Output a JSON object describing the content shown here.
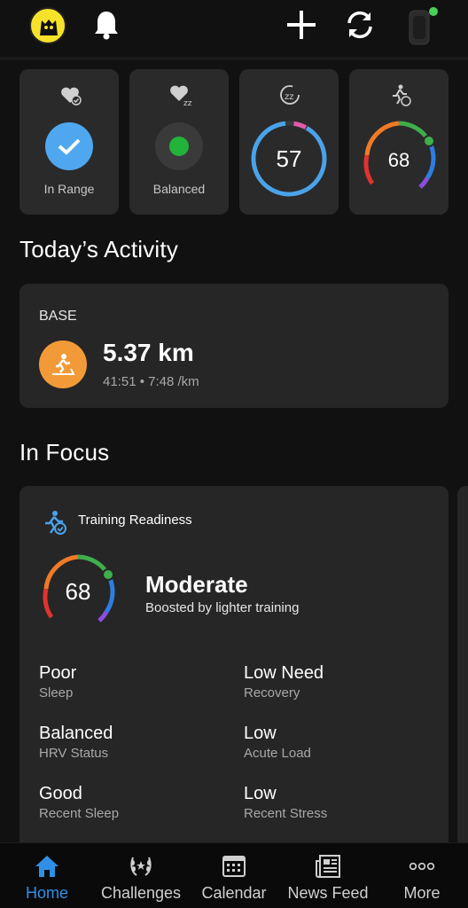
{
  "header": {
    "avatar_icon": "profile-avatar-icon",
    "notifications_icon": "bell-icon",
    "add_icon": "plus-icon",
    "sync_icon": "sync-icon",
    "device_icon": "watch-icon",
    "device_status_color": "#4ccf5a"
  },
  "tiles": [
    {
      "icon": "heart-check-icon",
      "label": "In Range",
      "indicator_color": "#4fa8ef"
    },
    {
      "icon": "heart-zz-icon",
      "label": "Balanced",
      "indicator_color": "#22b33a"
    },
    {
      "icon": "sleep-score-icon",
      "value": "57",
      "ring_color": "#4aa3ea",
      "ring_fraction": 0.57
    },
    {
      "icon": "training-readiness-icon",
      "value": "68",
      "ring_fraction": 0.68
    }
  ],
  "activity": {
    "heading": "Today’s Activity",
    "card_title": "BASE",
    "icon": "treadmill-icon",
    "icon_color": "#f39a38",
    "distance": "5.37 km",
    "details": "41:51 • 7:48 /km"
  },
  "focus": {
    "heading": "In Focus",
    "card_title": "Training Readiness",
    "icon": "training-readiness-icon",
    "score": "68",
    "score_fraction": 0.68,
    "level": "Moderate",
    "level_sub": "Boosted by lighter training",
    "stats": [
      {
        "value": "Poor",
        "label": "Sleep"
      },
      {
        "value": "Low Need",
        "label": "Recovery"
      },
      {
        "value": "Balanced",
        "label": "HRV Status"
      },
      {
        "value": "Low",
        "label": "Acute Load"
      },
      {
        "value": "Good",
        "label": "Recent Sleep"
      },
      {
        "value": "Low",
        "label": "Recent Stress"
      }
    ]
  },
  "nav": {
    "accent": "#2f8fe6",
    "items": [
      {
        "label": "Home",
        "icon": "home-icon",
        "active": true
      },
      {
        "label": "Challenges",
        "icon": "laurel-icon"
      },
      {
        "label": "Calendar",
        "icon": "calendar-icon"
      },
      {
        "label": "News Feed",
        "icon": "newspaper-icon"
      },
      {
        "label": "More",
        "icon": "more-dots-icon"
      }
    ]
  }
}
